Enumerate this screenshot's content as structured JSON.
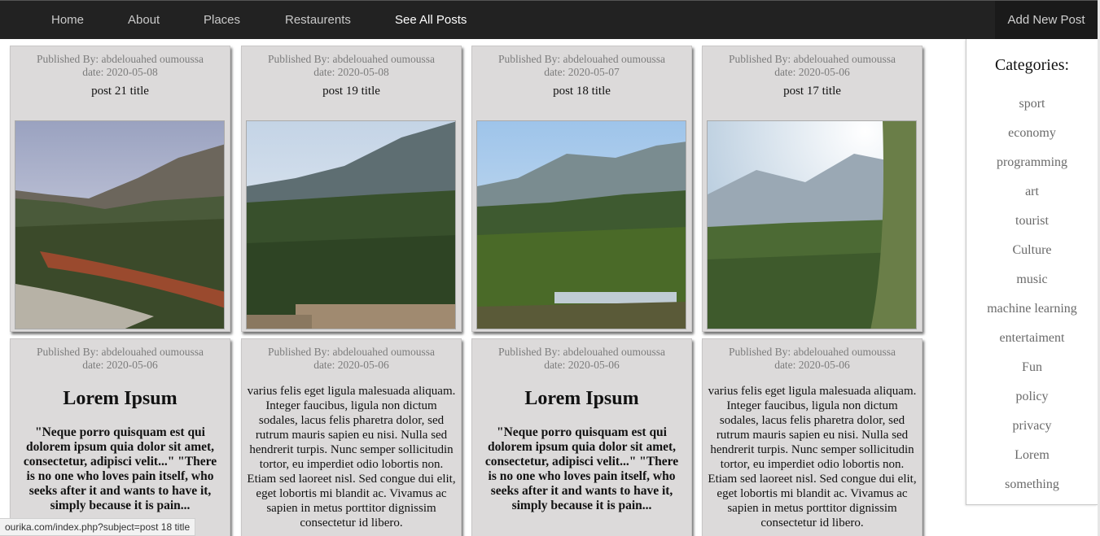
{
  "nav": {
    "links": [
      "Home",
      "About",
      "Places",
      "Restaurents",
      "See All Posts"
    ],
    "add_post": "Add New Post"
  },
  "posts_row1": [
    {
      "author": "Published By: abdelouahed oumoussa",
      "date": "date: 2020-05-08",
      "title": "post 21 title"
    },
    {
      "author": "Published By: abdelouahed oumoussa",
      "date": "date: 2020-05-08",
      "title": "post 19 title"
    },
    {
      "author": "Published By: abdelouahed oumoussa",
      "date": "date: 2020-05-07",
      "title": "post 18 title"
    },
    {
      "author": "Published By: abdelouahed oumoussa",
      "date": "date: 2020-05-06",
      "title": "post 17 title"
    }
  ],
  "posts_row2": [
    {
      "author": "Published By: abdelouahed oumoussa",
      "date": "date: 2020-05-06",
      "heading": "Lorem Ipsum",
      "quote": "\"Neque porro quisquam est qui dolorem ipsum quia dolor sit amet, consectetur, adipisci velit...\" \"There is no one who loves pain itself, who seeks after it and wants to have it, simply because it is pain..."
    },
    {
      "author": "Published By: abdelouahed oumoussa",
      "date": "date: 2020-05-06",
      "body": "varius felis eget ligula malesuada aliquam. Integer faucibus, ligula non dictum sodales, lacus felis pharetra dolor, sed rutrum mauris sapien eu nisi. Nulla sed hendrerit turpis. Nunc semper sollicitudin tortor, eu imperdiet odio lobortis non. Etiam sed laoreet nisl. Sed congue dui elit, eget lobortis mi blandit ac. Vivamus ac sapien in metus porttitor dignissim consectetur id libero."
    },
    {
      "author": "Published By: abdelouahed oumoussa",
      "date": "date: 2020-05-06",
      "heading": "Lorem Ipsum",
      "quote": "\"Neque porro quisquam est qui dolorem ipsum quia dolor sit amet, consectetur, adipisci velit...\" \"There is no one who loves pain itself, who seeks after it and wants to have it, simply because it is pain..."
    },
    {
      "author": "Published By: abdelouahed oumoussa",
      "date": "date: 2020-05-06",
      "body": "varius felis eget ligula malesuada aliquam. Integer faucibus, ligula non dictum sodales, lacus felis pharetra dolor, sed rutrum mauris sapien eu nisi. Nulla sed hendrerit turpis. Nunc semper sollicitudin tortor, eu imperdiet odio lobortis non. Etiam sed laoreet nisl. Sed congue dui elit, eget lobortis mi blandit ac. Vivamus ac sapien in metus porttitor dignissim consectetur id libero."
    }
  ],
  "sidebar": {
    "heading": "Categories:",
    "categories": [
      "sport",
      "economy",
      "programming",
      "art",
      "tourist",
      "Culture",
      "music",
      "machine learning",
      "entertaiment",
      "Fun",
      "policy",
      "privacy",
      "Lorem",
      "something"
    ]
  },
  "status_bar": "ourika.com/index.php?subject=post 18 title"
}
